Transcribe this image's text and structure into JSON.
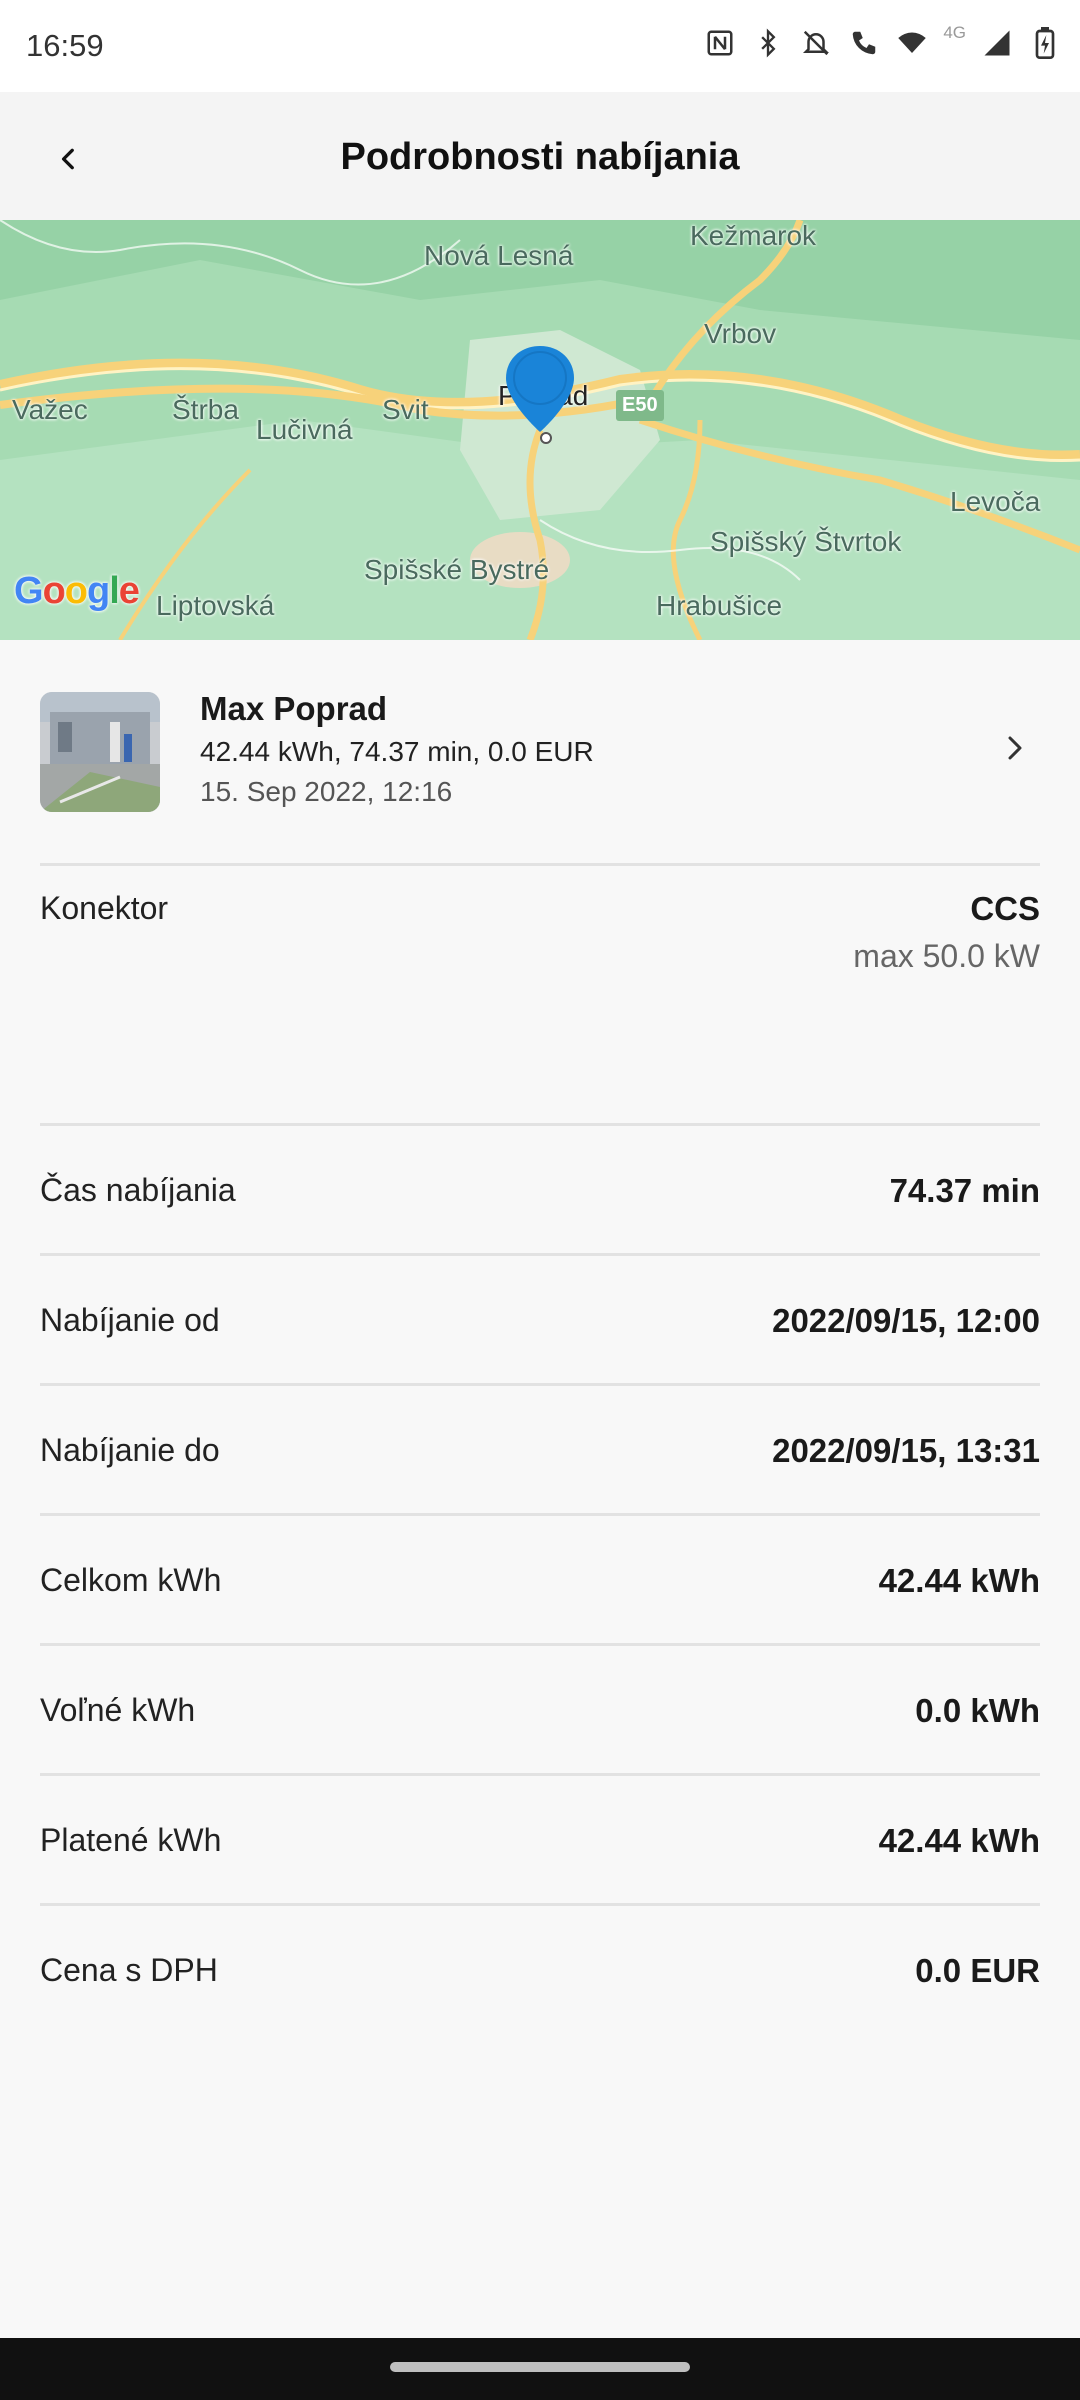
{
  "status_bar": {
    "time": "16:59",
    "network_label": "4G",
    "icons": [
      "nfc-icon",
      "bluetooth-icon",
      "mute-icon",
      "call-icon",
      "wifi-icon",
      "signal-icon",
      "battery-charging-icon"
    ]
  },
  "header": {
    "title": "Podrobnosti nabíjania",
    "back_icon": "chevron-left-icon"
  },
  "map": {
    "labels": {
      "nova_lesna": "Nová Lesná",
      "kezmarok": "Kežmarok",
      "vrbov": "Vrbov",
      "vazec": "Važec",
      "strba": "Štrba",
      "lucivna": "Lučivná",
      "svit": "Svit",
      "poprad": "Poprad",
      "levoca": "Levoča",
      "spissky_stvrtok": "Spišský Štvrtok",
      "spisske_bystre": "Spišské Bystré",
      "liptovska": "Liptovská",
      "hrabusice": "Hrabušice"
    },
    "road_shield": "E50",
    "attribution": [
      "G",
      "o",
      "o",
      "g",
      "l",
      "e"
    ],
    "marker_color": "#1a84d8"
  },
  "station": {
    "name": "Max Poprad",
    "summary": "42.44 kWh, 74.37 min, 0.0 EUR",
    "date": "15. Sep 2022, 12:16"
  },
  "connector": {
    "label": "Konektor",
    "type": "CCS",
    "power": "max 50.0 kW"
  },
  "details": [
    {
      "label": "Čas nabíjania",
      "value": "74.37 min"
    },
    {
      "label": "Nabíjanie od",
      "value": "2022/09/15, 12:00"
    },
    {
      "label": "Nabíjanie do",
      "value": "2022/09/15, 13:31"
    },
    {
      "label": "Celkom kWh",
      "value": "42.44 kWh"
    },
    {
      "label": "Voľné kWh",
      "value": "0.0 kWh"
    },
    {
      "label": "Platené kWh",
      "value": "42.44 kWh"
    },
    {
      "label": "Cena s DPH",
      "value": "0.0 EUR"
    }
  ]
}
